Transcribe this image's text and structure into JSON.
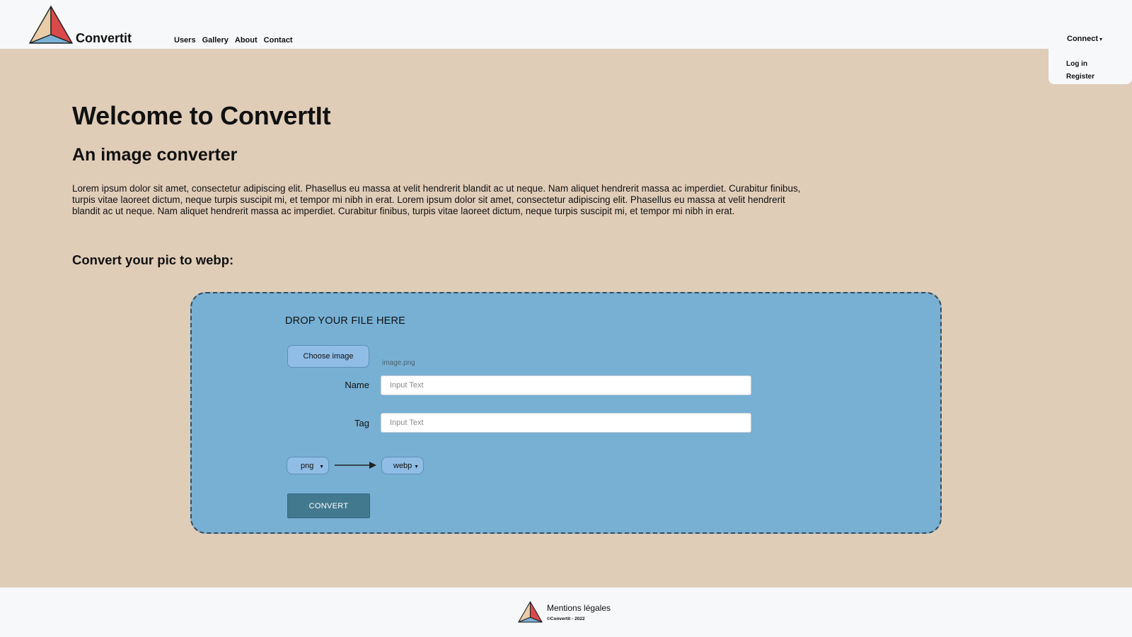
{
  "header": {
    "brand": "Convertit",
    "nav": [
      "Users",
      "Gallery",
      "About",
      "Contact"
    ],
    "connect_label": "Connect",
    "dropdown": [
      "Log in",
      "Register"
    ]
  },
  "main": {
    "title": "Welcome to ConvertIt",
    "subtitle": "An image converter",
    "paragraph": "Lorem ipsum dolor sit amet, consectetur adipiscing elit. Phasellus eu massa at velit hendrerit blandit ac ut neque. Nam aliquet hendrerit massa ac imperdiet. Curabitur finibus, turpis vitae laoreet dictum, neque turpis suscipit mi, et tempor mi nibh in erat. Lorem ipsum dolor sit amet, consectetur adipiscing elit. Phasellus eu massa at velit hendrerit blandit ac ut neque. Nam aliquet hendrerit massa ac imperdiet. Curabitur finibus, turpis vitae laoreet dictum, neque turpis suscipit mi, et tempor mi nibh in erat.",
    "convert_heading": "Convert your pic to webp:"
  },
  "dropzone": {
    "title": "DROP YOUR FILE HERE",
    "choose_label": "Choose image",
    "filename": "image.png",
    "name_label": "Name",
    "name_placeholder": "Input Text",
    "tag_label": "Tag",
    "tag_placeholder": "Input Text",
    "from_format": "png",
    "to_format": "webp",
    "convert_label": "CONVERT"
  },
  "footer": {
    "link": "Mentions légales",
    "copyright": "©Convertit - 2022"
  },
  "colors": {
    "page_bg": "#e0cdb8",
    "header_bg": "#f6f8fa",
    "dropzone_bg": "#78b0d4",
    "button_light": "#8fbde6",
    "convert_button": "#42798f"
  },
  "icons": {
    "logo": "triangle-logo-icon",
    "dropdown_caret": "caret-down-icon",
    "arrow": "arrow-right-icon"
  }
}
